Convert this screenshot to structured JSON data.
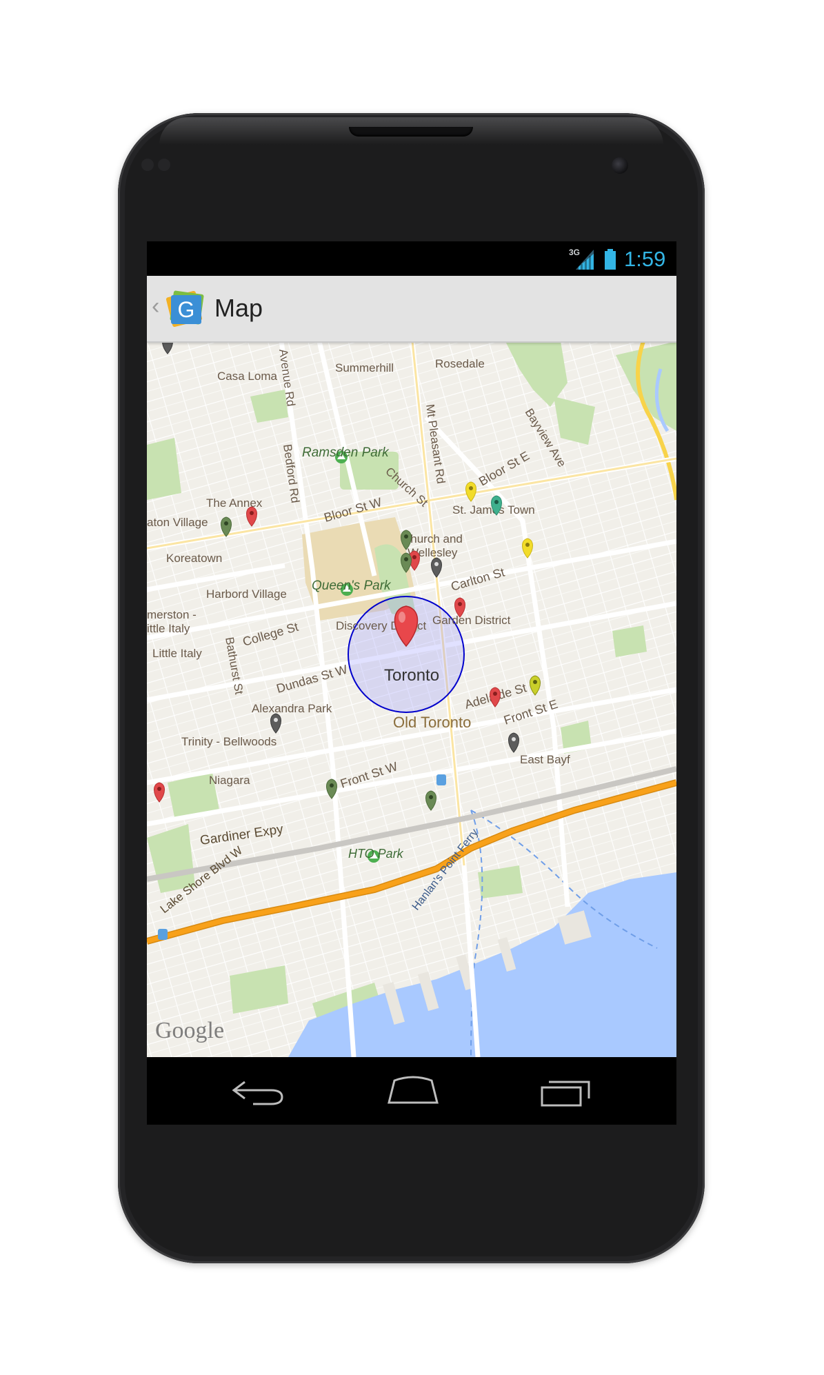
{
  "status_bar": {
    "network": "3G",
    "time": "1:59",
    "accent_color": "#33b5e5"
  },
  "action_bar": {
    "up_caret": "‹",
    "app_icon_letter": "G",
    "title": "Map"
  },
  "map": {
    "labels": {
      "casa_loma": "Casa Loma",
      "summerhill": "Summerhill",
      "rosedale": "Rosedale",
      "avenue_rd": "Avenue Rd",
      "bayview_ave": "Bayview Ave",
      "ramsden_park": "Ramsden Park",
      "bedford_rd": "Bedford Rd",
      "church_st": "Church St",
      "mt_pleasant_rd": "Mt Pleasant Rd",
      "bloor_st_e": "Bloor St E",
      "the_annex": "The Annex",
      "bloor_st_w": "Bloor St W",
      "st_james_town": "St. James Town",
      "seaton_village": "aton Village",
      "church_and_wellesley_1": "Church and",
      "church_and_wellesley_2": "Wellesley",
      "koreatown": "Koreatown",
      "carlton_st": "Carlton St",
      "queens_park": "Queen's Park",
      "harbord_village": "Harbord Village",
      "palmerston_1": "merston -",
      "palmerston_2": "ittle Italy",
      "discovery_district": "Discovery District",
      "garden_district": "Garden District",
      "college_st": "College St",
      "little_italy": "Little Italy",
      "bathurst_st": "Bathurst St",
      "toronto": "Toronto",
      "dundas_st_w": "Dundas St W",
      "adelaide_st": "Adelaide St",
      "alexandra_park": "Alexandra Park",
      "front_st_e": "Front St E",
      "old_toronto": "Old Toronto",
      "trinity_bellwoods": "Trinity - Bellwoods",
      "east_bayfront": "East Bayf",
      "niagara": "Niagara",
      "front_st_w": "Front St W",
      "gardiner_expy": "Gardiner Expy",
      "hto_park": "HTO Park",
      "lake_shore_blvd_w": "Lake Shore Blvd W",
      "hanlans_point_ferry": "Hanlan's Point Ferry"
    },
    "google_logo": "Google",
    "colors": {
      "land": "#f1efe9",
      "water": "#a9c9ff",
      "park": "#c8e2b1",
      "campus": "#eadbb4",
      "highway": "#f8a11a",
      "selection_circle": "#0000cc"
    },
    "markers": [
      {
        "color": "red",
        "label": "selected-location"
      },
      {
        "color": "red"
      },
      {
        "color": "red"
      },
      {
        "color": "red"
      },
      {
        "color": "red"
      },
      {
        "color": "red"
      },
      {
        "color": "green"
      },
      {
        "color": "green"
      },
      {
        "color": "green"
      },
      {
        "color": "green"
      },
      {
        "color": "green"
      },
      {
        "color": "teal"
      },
      {
        "color": "yellow"
      },
      {
        "color": "yellow"
      },
      {
        "color": "yellow"
      },
      {
        "color": "gray"
      },
      {
        "color": "gray"
      },
      {
        "color": "gray"
      },
      {
        "color": "gray"
      }
    ]
  },
  "nav_bar": {
    "back": "back-icon",
    "home": "home-icon",
    "recents": "recents-icon"
  }
}
